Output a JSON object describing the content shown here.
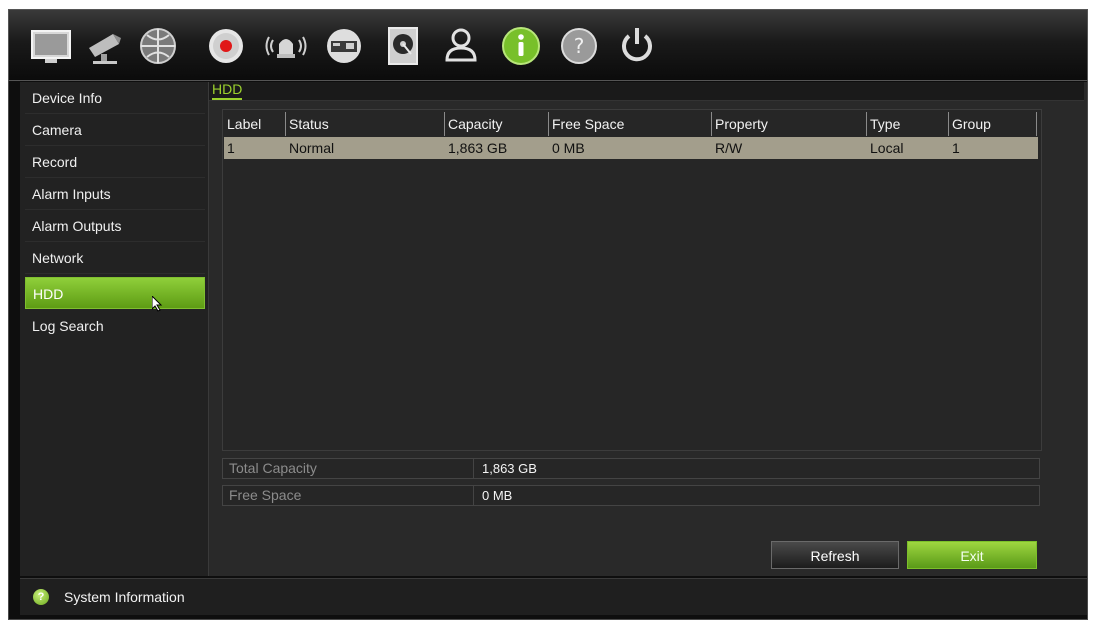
{
  "toolbar": {
    "icons": [
      "monitor-icon",
      "camera-icon",
      "network-globe-icon",
      "record-icon",
      "alarm-icon",
      "device-icon",
      "hdd-icon",
      "user-icon",
      "info-icon",
      "help-icon",
      "power-icon"
    ]
  },
  "sidebar": {
    "items": [
      {
        "label": "Device Info"
      },
      {
        "label": "Camera"
      },
      {
        "label": "Record"
      },
      {
        "label": "Alarm Inputs"
      },
      {
        "label": "Alarm Outputs"
      },
      {
        "label": "Network"
      },
      {
        "label": "HDD"
      },
      {
        "label": "Log Search"
      }
    ],
    "active_index": 6
  },
  "main": {
    "breadcrumb": "HDD",
    "table": {
      "columns": [
        "Label",
        "Status",
        "Capacity",
        "Free Space",
        "Property",
        "Type",
        "Group"
      ],
      "rows": [
        [
          "1",
          "Normal",
          "1,863 GB",
          "0 MB",
          "R/W",
          "Local",
          "1"
        ]
      ]
    },
    "summary": {
      "total_capacity_label": "Total Capacity",
      "total_capacity_value": "1,863 GB",
      "free_space_label": "Free Space",
      "free_space_value": "0 MB"
    },
    "buttons": {
      "refresh": "Refresh",
      "exit": "Exit"
    }
  },
  "status_bar": {
    "text": "System Information"
  },
  "colors": {
    "accent_green": "#8cc63f",
    "row_selected": "#a39e8c",
    "record_red": "#e01818"
  }
}
